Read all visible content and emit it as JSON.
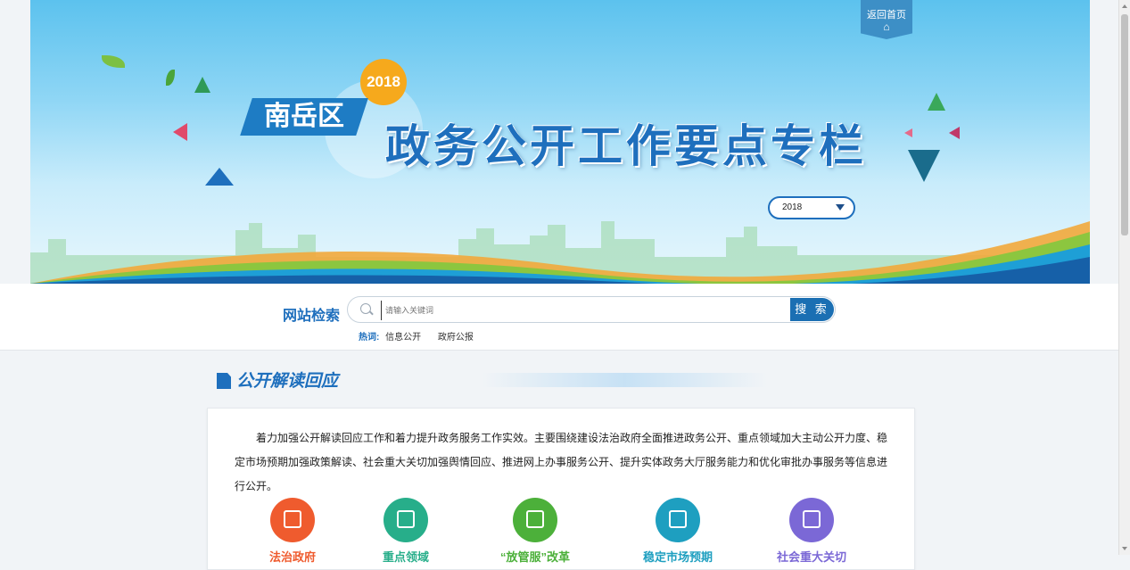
{
  "banner": {
    "home_link": "返回首页",
    "year_badge": "2018",
    "district": "南岳区",
    "title": "政务公开工作要点专栏",
    "year_select": "2018"
  },
  "search": {
    "label": "网站检索",
    "placeholder": "请输入关键词",
    "button": "搜 索",
    "hot_label": "热词:",
    "hot_items": [
      "信息公开",
      "政府公报"
    ]
  },
  "section": {
    "title": "公开解读回应",
    "intro": "着力加强公开解读回应工作和着力提升政务服务工作实效。主要围绕建设法治政府全面推进政务公开、重点领域加大主动公开力度、稳定市场预期加强政策解读、社会重大关切加强舆情回应、推进网上办事服务公开、提升实体政务大厅服务能力和优化审批办事服务等信息进行公开。",
    "categories": [
      {
        "label": "法治政府",
        "color": "#ef5b2e"
      },
      {
        "label": "重点领域",
        "color": "#27ae8a"
      },
      {
        "label": "“放管服”改革",
        "color": "#4cb03a"
      },
      {
        "label": "稳定市场预期",
        "color": "#1e9fc0"
      },
      {
        "label": "社会重大关切",
        "color": "#7b68d6"
      }
    ]
  }
}
